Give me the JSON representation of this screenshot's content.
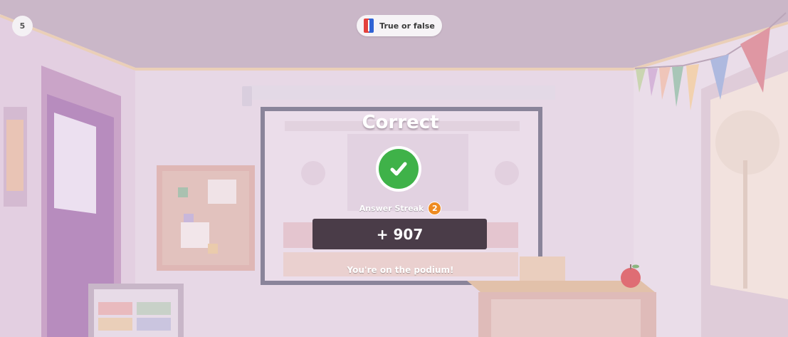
{
  "hud": {
    "question_number": "5",
    "question_type": "True or false",
    "question_type_icon": "true-false-icon"
  },
  "result": {
    "title": "Correct",
    "icon": "checkmark-icon",
    "streak_label": "Answer Streak",
    "streak_count": "2",
    "points": "+ 907",
    "message": "You're on the podium!"
  },
  "colors": {
    "correct_green": "#3fb249",
    "points_bar": "#4a3c48",
    "streak_badge": "#ee8a21"
  }
}
